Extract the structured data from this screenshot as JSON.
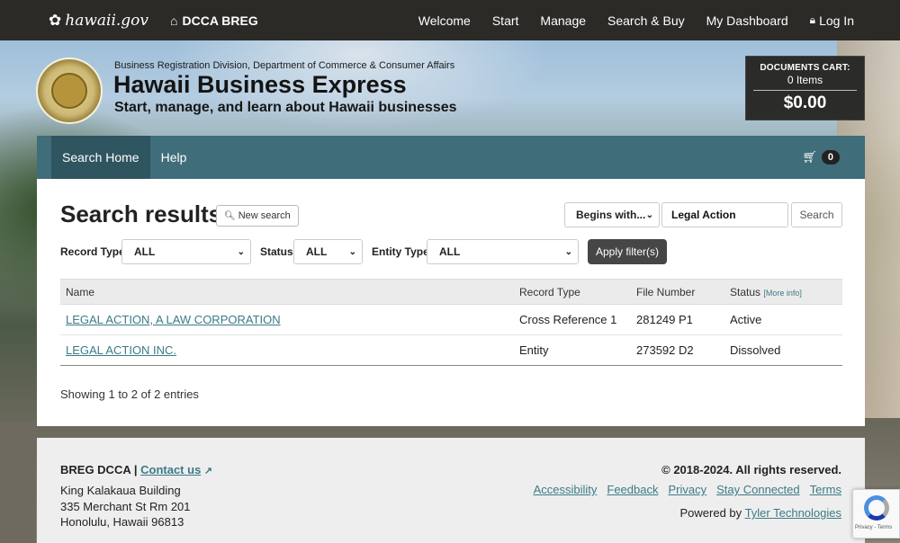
{
  "topnav": {
    "brand_text": "hawaii.gov",
    "home_label": "DCCA BREG",
    "links": [
      "Welcome",
      "Start",
      "Manage",
      "Search & Buy",
      "My Dashboard"
    ],
    "login_label": "Log In"
  },
  "header": {
    "division": "Business Registration Division, Department of Commerce & Consumer Affairs",
    "title": "Hawaii Business Express",
    "tagline": "Start, manage, and learn about Hawaii businesses",
    "cart": {
      "label": "DOCUMENTS CART:",
      "items": "0 Items",
      "total": "$0.00"
    }
  },
  "subnav": {
    "tabs": [
      "Search Home",
      "Help"
    ],
    "cart_count": "0"
  },
  "search": {
    "page_title": "Search results",
    "new_search_label": "New search",
    "match_mode": "Begins with...",
    "query": "Legal Action",
    "search_button": "Search",
    "filters": {
      "record_type_label": "Record Type",
      "record_type_value": "ALL",
      "status_label": "Status",
      "status_value": "ALL",
      "entity_type_label": "Entity Type",
      "entity_type_value": "ALL",
      "apply_label": "Apply filter(s)"
    }
  },
  "table": {
    "headers": {
      "name": "Name",
      "record_type": "Record Type",
      "file_number": "File Number",
      "status": "Status",
      "more_info": "[More info]"
    },
    "rows": [
      {
        "name": "LEGAL ACTION, A LAW CORPORATION",
        "record_type": "Cross Reference 1",
        "file_number": "281249 P1",
        "status": "Active"
      },
      {
        "name": "LEGAL ACTION INC.",
        "record_type": "Entity",
        "file_number": "273592 D2",
        "status": "Dissolved"
      }
    ],
    "entries_text": "Showing 1 to 2 of 2 entries"
  },
  "footer": {
    "org": "BREG DCCA |",
    "contact": "Contact us",
    "address_line1": "King Kalakaua Building",
    "address_line2": "335 Merchant St Rm 201",
    "address_line3": "Honolulu, Hawaii 96813",
    "copyright": "© 2018-2024. All rights reserved.",
    "links": [
      "Accessibility",
      "Feedback",
      "Privacy",
      "Stay Connected",
      "Terms"
    ],
    "powered_prefix": "Powered by",
    "powered_link": "Tyler Technologies"
  },
  "recaptcha": {
    "text": "Privacy - Terms"
  },
  "icons": {
    "brand": "hibiscus-icon",
    "home": "home-icon",
    "lock": "lock-icon",
    "cart": "cart-icon",
    "search": "search-icon",
    "external": "external-link-icon"
  },
  "colors": {
    "topnav": "#2c2a27",
    "subnav": "#3f6d79",
    "subnav_active": "#2f5560",
    "link": "#3b7b87",
    "apply_button": "#464646"
  }
}
